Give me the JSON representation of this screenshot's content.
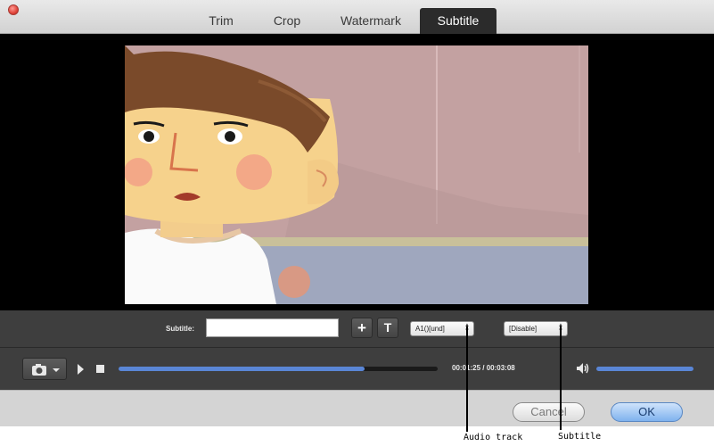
{
  "window": {
    "tabs": [
      {
        "label": "Trim",
        "active": false
      },
      {
        "label": "Crop",
        "active": false
      },
      {
        "label": "Watermark",
        "active": false
      },
      {
        "label": "Subtitle",
        "active": true
      }
    ]
  },
  "subtitle_panel": {
    "label": "Subtitle:",
    "input_value": "",
    "add_icon": "plus-icon",
    "font_icon": "text-T-icon",
    "audio_track_value": "A1()[und]",
    "subtitle_value": "[Disable]"
  },
  "playback": {
    "time_display": "00:01:25 / 00:03:08",
    "progress_fraction": 0.77,
    "volume_fraction": 1.0,
    "camera_icon": "camera-icon",
    "play_icon": "play-icon",
    "stop_icon": "stop-icon",
    "volume_icon": "speaker-icon"
  },
  "buttons": {
    "cancel_label": "Cancel",
    "ok_label": "OK"
  },
  "annotations": {
    "audio_track": "Audio track",
    "subtitle": "Subtitle"
  },
  "colors": {
    "accent": "#5a86d6",
    "panel": "#3e3e3e",
    "close_button": "#e0443a"
  }
}
